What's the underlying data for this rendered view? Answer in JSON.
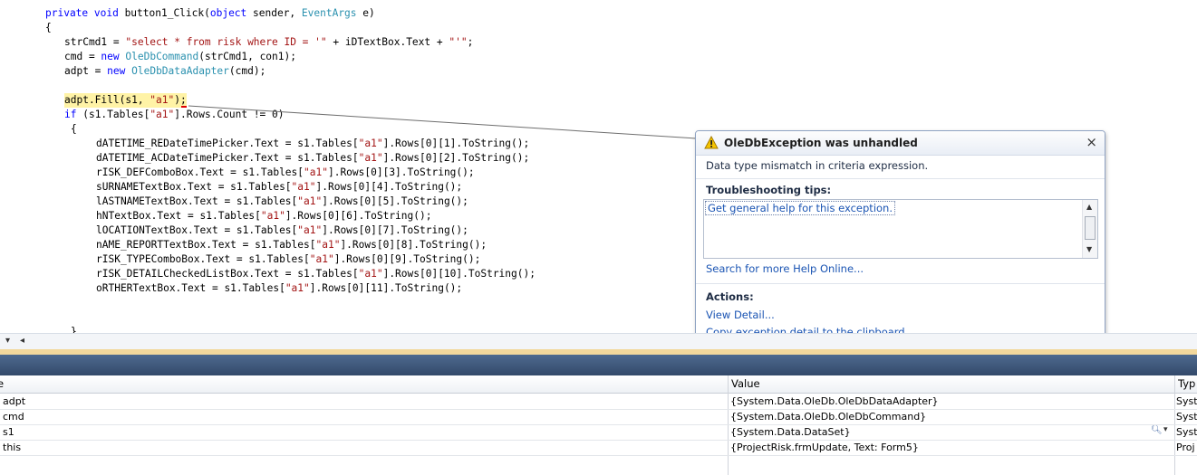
{
  "editor": {
    "line1": {
      "kw": "private void ",
      "rest": "button1_Click(",
      "kw2": "object",
      "mid": " sender, ",
      "ty": "EventArgs",
      "end": " e)"
    },
    "line2": "{",
    "line3": {
      "a": "strCmd1 = ",
      "s1": "\"select * from risk where ID = '\"",
      "b": " + iDTextBox.Text + ",
      "s2": "\"'\"",
      "c": ";"
    },
    "line4": {
      "a": "cmd = ",
      "kw": "new",
      "sp": " ",
      "ty": "OleDbCommand",
      "b": "(strCmd1, con1);"
    },
    "line5": {
      "a": "adpt = ",
      "kw": "new",
      "sp": " ",
      "ty": "OleDbDataAdapter",
      "b": "(cmd);"
    },
    "line6": {
      "a": "adpt.Fill(s1, ",
      "s": "\"a1\"",
      "b": ");"
    },
    "line7": {
      "kw": "if",
      "a": " (s1.Tables[",
      "s": "\"a1\"",
      "b": "].Rows.Count != 0)"
    },
    "line8": "{",
    "assignments": [
      {
        "left": "dATETIME_REDateTimePicker.Text = s1.Tables[",
        "idx": "].Rows[0][1].ToString();"
      },
      {
        "left": "dATETIME_ACDateTimePicker.Text = s1.Tables[",
        "idx": "].Rows[0][2].ToString();"
      },
      {
        "left": "rISK_DEFComboBox.Text = s1.Tables[",
        "idx": "].Rows[0][3].ToString();"
      },
      {
        "left": "sURNAMETextBox.Text = s1.Tables[",
        "idx": "].Rows[0][4].ToString();"
      },
      {
        "left": "lASTNAMETextBox.Text = s1.Tables[",
        "idx": "].Rows[0][5].ToString();"
      },
      {
        "left": "hNTextBox.Text = s1.Tables[",
        "idx": "].Rows[0][6].ToString();"
      },
      {
        "left": "lOCATIONTextBox.Text = s1.Tables[",
        "idx": "].Rows[0][7].ToString();"
      },
      {
        "left": "nAME_REPORTTextBox.Text = s1.Tables[",
        "idx": "].Rows[0][8].ToString();"
      },
      {
        "left": "rISK_TYPEComboBox.Text = s1.Tables[",
        "idx": "].Rows[0][9].ToString();"
      },
      {
        "left": "rISK_DETAILCheckedListBox.Text = s1.Tables[",
        "idx": "].Rows[0][10].ToString();"
      },
      {
        "left": "oRTHERTextBox.Text = s1.Tables[",
        "idx": "].Rows[0][11].ToString();"
      }
    ],
    "table_key": "\"a1\"",
    "closing": "}"
  },
  "exception": {
    "title": "OleDbException was unhandled",
    "message": "Data type mismatch in criteria expression.",
    "tips_heading": "Troubleshooting tips:",
    "tip_link": "Get general help for this exception.",
    "search_link": "Search for more Help Online...",
    "actions_heading": "Actions:",
    "view_detail": "View Detail...",
    "copy_detail": "Copy exception detail to the clipboard",
    "close_glyph": "×",
    "warning_icon": "warning-icon"
  },
  "locals": {
    "headers": {
      "name": "e",
      "value": "Value",
      "type": "Typ"
    },
    "rows": [
      {
        "name": "adpt",
        "value": "{System.Data.OleDb.OleDbDataAdapter}",
        "type": "Syst",
        "magnifier": false
      },
      {
        "name": "cmd",
        "value": "{System.Data.OleDb.OleDbCommand}",
        "type": "Syst",
        "magnifier": false
      },
      {
        "name": "s1",
        "value": "{System.Data.DataSet}",
        "type": "Syst",
        "magnifier": true
      },
      {
        "name": "this",
        "value": "{ProjectRisk.frmUpdate, Text: Form5}",
        "type": "Proj",
        "magnifier": false
      }
    ]
  },
  "scroll": {
    "left_glyph": "▾",
    "arrow_glyph": "◂"
  },
  "colors": {
    "keyword": "#0000ff",
    "type": "#2b91af",
    "string": "#a31515",
    "highlight": "#fff3a6",
    "link": "#1a54b3"
  }
}
